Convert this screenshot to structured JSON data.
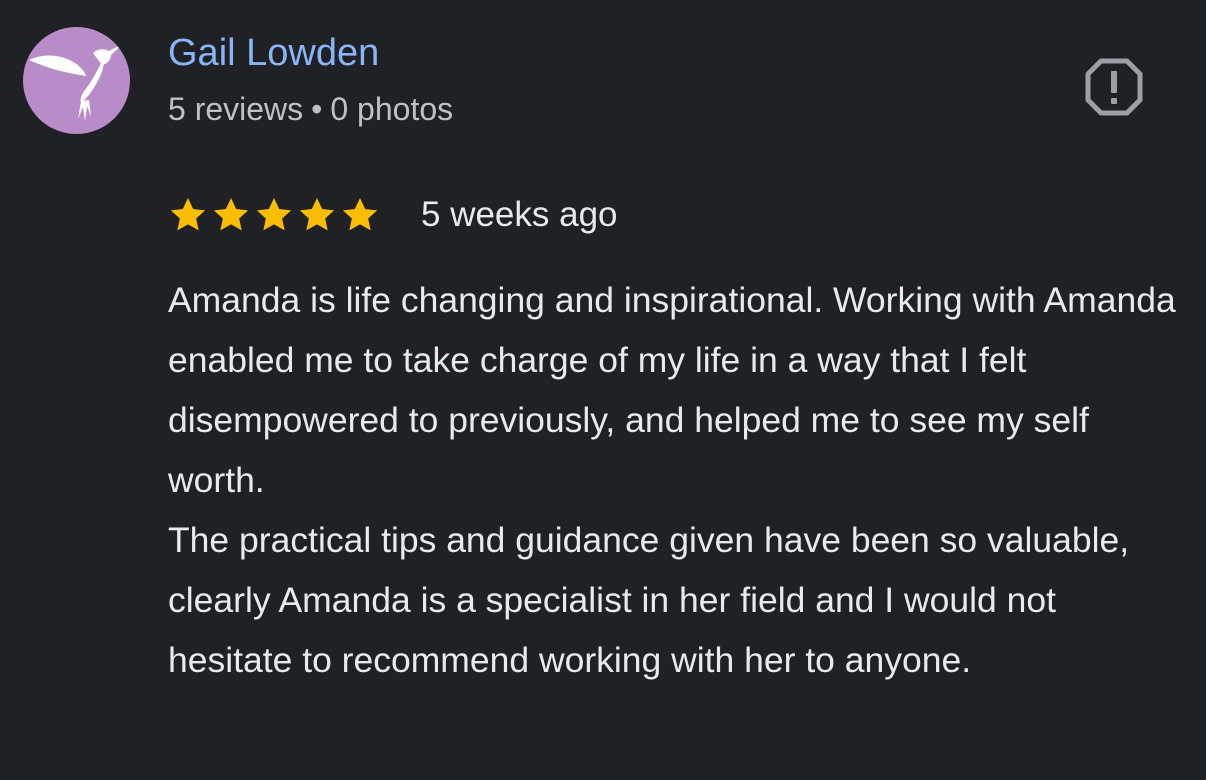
{
  "author": {
    "name": "Gail Lowden",
    "reviews": "5 reviews",
    "separator": "•",
    "photos": "0 photos",
    "avatar_color": "#b88cc8",
    "avatar_icon": "hummingbird-icon"
  },
  "actions": {
    "report_icon": "report-flag-icon"
  },
  "review": {
    "rating": 5,
    "max_rating": 5,
    "star_color": "#fbbc04",
    "date": "5 weeks ago",
    "paragraphs": [
      "Amanda is life changing and inspirational. Working with Amanda enabled me to take charge of my life in a way that I felt disempowered to previously, and helped me to see my self worth.",
      "The practical tips and guidance given have been so valuable, clearly Amanda is a specialist in her field and I would not hesitate to recommend working with her to anyone."
    ]
  },
  "colors": {
    "background": "#202124",
    "name": "#8ab4f8",
    "meta": "#bdc1c6",
    "text": "#e8eaed",
    "icon": "#9aa0a6"
  }
}
